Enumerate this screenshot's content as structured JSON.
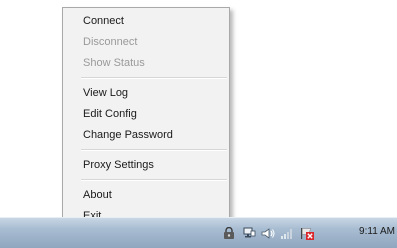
{
  "menu": {
    "items": [
      {
        "label": "Connect",
        "enabled": true
      },
      {
        "label": "Disconnect",
        "enabled": false
      },
      {
        "label": "Show Status",
        "enabled": false
      },
      {
        "label": "View Log",
        "enabled": true
      },
      {
        "label": "Edit Config",
        "enabled": true
      },
      {
        "label": "Change Password",
        "enabled": true
      },
      {
        "label": "Proxy Settings",
        "enabled": true
      },
      {
        "label": "About",
        "enabled": true
      },
      {
        "label": "Exit",
        "enabled": true
      }
    ]
  },
  "taskbar": {
    "clock": "9:11 AM",
    "tray_icons": [
      "tray-app-icon",
      "network-icon",
      "volume-icon",
      "signal-icon",
      "flag-icon"
    ]
  },
  "colors": {
    "menu_bg": "#f2f2f2",
    "menu_text": "#1a1a1a",
    "menu_disabled_text": "#9a9a9a",
    "taskbar": "#a9bdd2",
    "flag_red": "#d8262a"
  }
}
